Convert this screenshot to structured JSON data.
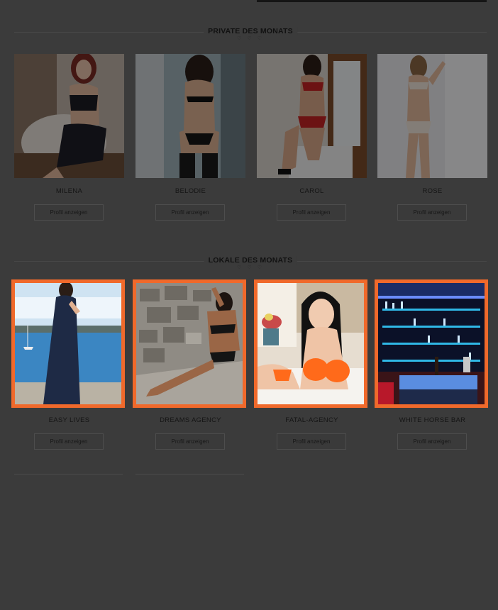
{
  "sections": [
    {
      "title": "PRIVATE DES MONATS",
      "hearts": "♡ ♡ ♡",
      "cards": [
        {
          "name": "MILENA",
          "button": "Profil anzeigen",
          "photo": "woman-black-lingerie-chair"
        },
        {
          "name": "BELODIE",
          "button": "Profil anzeigen",
          "photo": "woman-lace-lingerie-back"
        },
        {
          "name": "CAROL",
          "button": "Profil anzeigen",
          "photo": "woman-red-lingerie-window"
        },
        {
          "name": "ROSE",
          "button": "Profil anzeigen",
          "photo": "woman-beige-lingerie-window"
        }
      ]
    },
    {
      "title": "LOKALE DES MONATS",
      "hearts": "♡ ♡ ♡",
      "cards": [
        {
          "name": "EASY LIVES",
          "button": "Profil anzeigen",
          "photo": "woman-navy-dress-lake"
        },
        {
          "name": "DREAMS AGENCY",
          "button": "Profil anzeigen",
          "photo": "woman-black-lingerie-stone-wall"
        },
        {
          "name": "FATAL-AGENCY",
          "button": "Profil anzeigen",
          "photo": "woman-orange-lingerie-bed"
        },
        {
          "name": "WHITE HORSE BAR",
          "button": "Profil anzeigen",
          "photo": "bar-interior-neon"
        }
      ]
    }
  ],
  "colors": {
    "overlay": "#3b3b3b",
    "highlight_border": "#f0692b"
  }
}
